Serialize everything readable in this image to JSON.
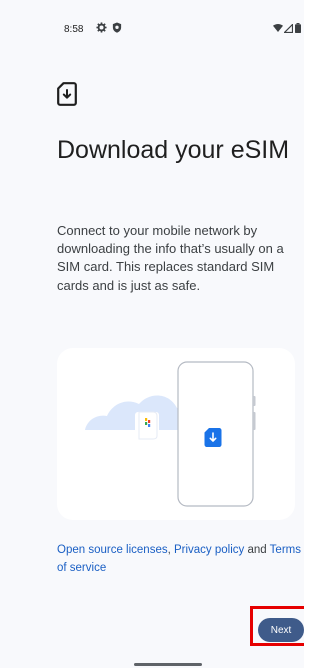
{
  "status_bar": {
    "time": "8:58",
    "icons": [
      "settings-gear-icon",
      "shield-icon",
      "wifi-icon",
      "signal-icon",
      "battery-icon"
    ]
  },
  "header": {
    "icon": "sim-download-icon",
    "title": "Download your eSIM"
  },
  "body": {
    "description": "Connect to your mobile network by downloading the info that’s usually on a SIM card. This replaces standard SIM cards and is just as safe."
  },
  "illustration": {
    "icons": [
      "cloud-icon",
      "phone-icon",
      "sim-card-icon"
    ]
  },
  "footer": {
    "open_source_link": "Open source licenses",
    "comma": ", ",
    "privacy_link": "Privacy policy",
    "and_text": " and ",
    "terms_link": "Terms of service"
  },
  "actions": {
    "next_label": "Next"
  },
  "colors": {
    "accent": "#3f5b8a",
    "link": "#1a5fc4",
    "highlight": "#e60000",
    "background": "#f8f9fc"
  }
}
